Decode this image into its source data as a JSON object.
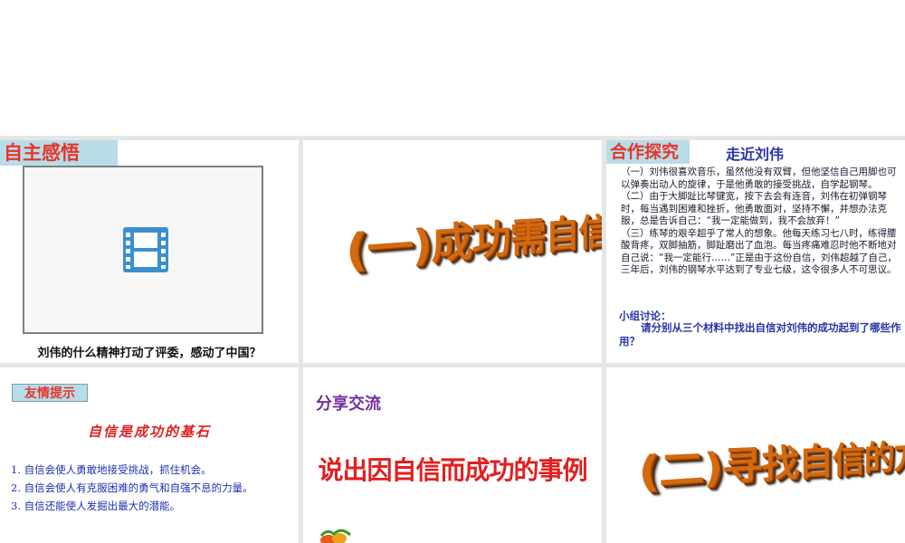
{
  "slides": {
    "s1": {
      "title": "自主感悟",
      "caption": "刘伟的什么精神打动了评委，感动了中国？",
      "icon": "video-film-icon"
    },
    "s2": {
      "wordart": "(一)成功需自信"
    },
    "s3": {
      "title": "合作探究",
      "subtitle": "走近刘伟",
      "paragraphs": [
        "（一）刘伟很喜欢音乐，虽然他没有双臂，但他坚信自己用脚也可以弹奏出动人的旋律，于是他勇敢的接受挑战，自学起钢琴。",
        "（二）由于大脚趾比琴键宽，按下去会有连音，刘伟在初弹钢琴时，每当遇到困难和挫折，他勇敢面对，坚持不懈，并想办法克服，总是告诉自己：“我一定能做到，我不会放弃！”",
        "（三）练琴的艰辛超乎了常人的想象。他每天练习七八时，练得腰酸背疼，双脚抽筋，脚趾磨出了血泡。每当疼痛难忍时他不断地对自己说：“我一定能行……”正是由于这份自信，刘伟超越了自己，三年后，刘伟的钢琴水平达到了专业七级，这令很多人不可思议。"
      ],
      "discussion_label": "小组讨论：",
      "discussion_text": "请分别从三个材料中找出自信对刘伟的成功起到了哪些作用？"
    },
    "s4": {
      "title": "友情提示",
      "headline": "自信是成功的基石",
      "items": [
        "1. 自信会使人勇敢地接受挑战，抓住机会。",
        "2. 自信会使人有克服困难的勇气和自强不息的力量。",
        "3. 自信还能使人发掘出最大的潜能。"
      ]
    },
    "s5": {
      "title": "分享交流",
      "text": "说出因自信而成功的事例"
    },
    "s6": {
      "wordart": "(二)寻找自信的方法"
    }
  },
  "colors": {
    "title_red": "#e8342a",
    "title_bg": "#b7dde8",
    "blue_text": "#2a35a8",
    "purple": "#7030a0",
    "wordart_orange": "#d36a10"
  }
}
